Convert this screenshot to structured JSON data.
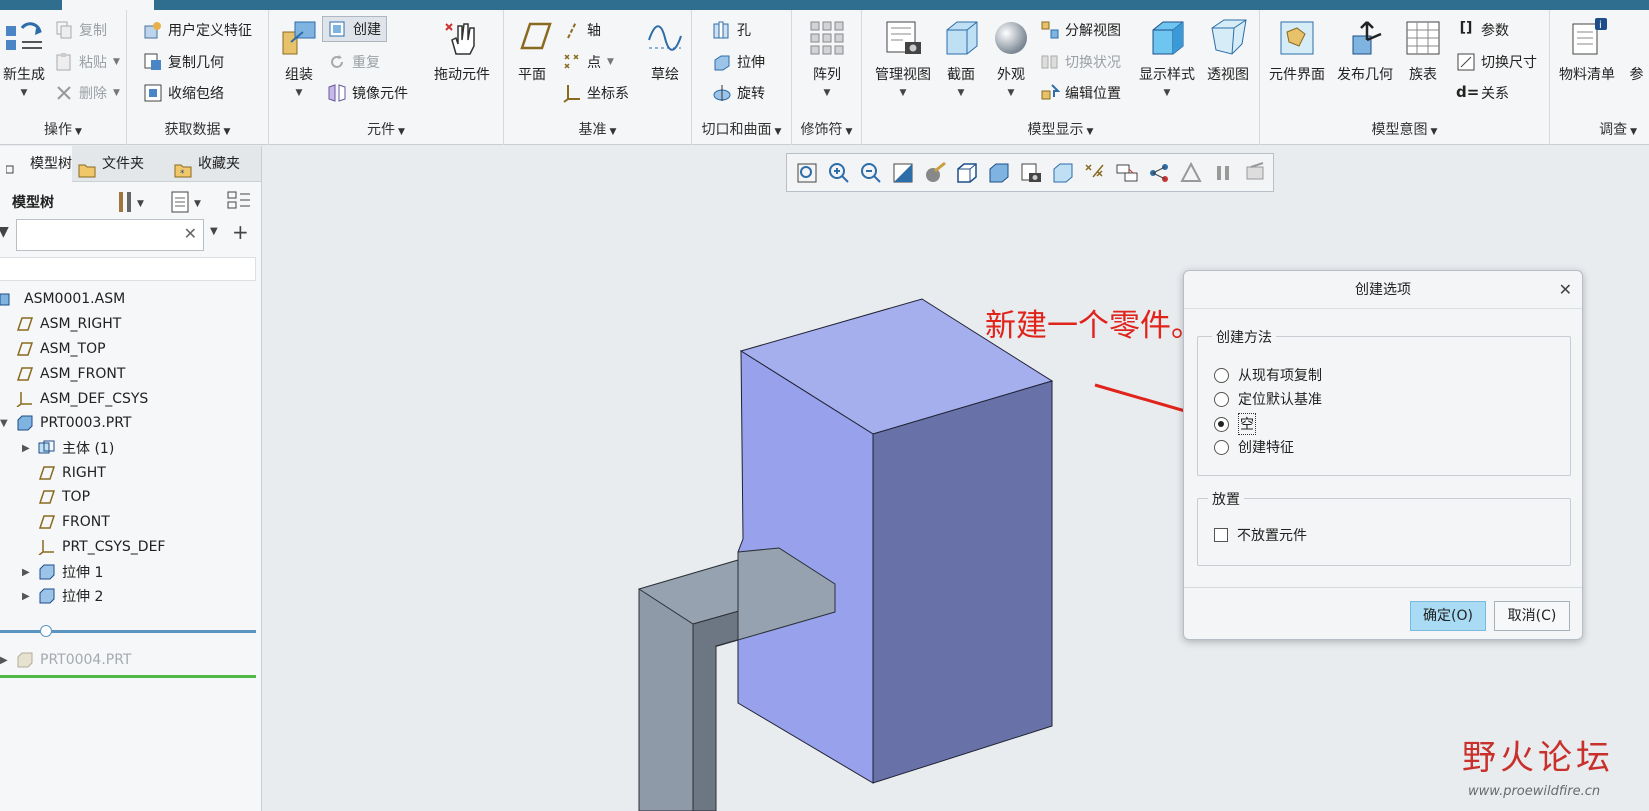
{
  "ribbon": {
    "groups": {
      "operations": "操作",
      "get_data": "获取数据",
      "component": "元件",
      "datum": "基准",
      "cut_surface": "切口和曲面",
      "modifiers": "修饰符",
      "model_display": "模型显示",
      "model_intent": "模型意图",
      "investigate": "调查"
    },
    "regenerate": "新生成",
    "copy": "复制",
    "paste": "粘贴",
    "delete": "删除",
    "user_defined_feature": "用户定义特征",
    "copy_geometry": "复制几何",
    "shrinkwrap": "收缩包络",
    "assemble": "组装",
    "create": "创建",
    "repeat": "重复",
    "mirror_component": "镜像元件",
    "drag_components": "拖动元件",
    "plane": "平面",
    "axis": "轴",
    "point": "点",
    "csys": "坐标系",
    "sketch": "草绘",
    "hole": "孔",
    "extrude": "拉伸",
    "revolve": "旋转",
    "pattern": "阵列",
    "manage_views": "管理视图",
    "section": "截面",
    "appearance": "外观",
    "exploded_view": "分解视图",
    "toggle_status": "切换状况",
    "edit_position": "编辑位置",
    "display_style": "显示样式",
    "perspective": "透视图",
    "component_interface": "元件界面",
    "publish_geometry": "发布几何",
    "family_table": "族表",
    "parameters": "参数",
    "switch_dimensions": "切换尺寸",
    "relations": "关系",
    "bom": "物料清单",
    "ref_cut": "参"
  },
  "panel": {
    "tabs": [
      "模型树",
      "文件夹",
      "收藏夹"
    ],
    "tree_title": "模型树",
    "filter_placeholder": "",
    "tree": [
      {
        "label": "ASM0001.ASM"
      },
      {
        "label": "ASM_RIGHT"
      },
      {
        "label": "ASM_TOP"
      },
      {
        "label": "ASM_FRONT"
      },
      {
        "label": "ASM_DEF_CSYS"
      },
      {
        "label": "PRT0003.PRT"
      },
      {
        "label": "主体 (1)"
      },
      {
        "label": "RIGHT"
      },
      {
        "label": "TOP"
      },
      {
        "label": "FRONT"
      },
      {
        "label": "PRT_CSYS_DEF"
      },
      {
        "label": "拉伸 1"
      },
      {
        "label": "拉伸 2"
      },
      {
        "label": "PRT0004.PRT"
      }
    ]
  },
  "dialog": {
    "title": "创建选项",
    "method_legend": "创建方法",
    "options": [
      "从现有项复制",
      "定位默认基准",
      "空",
      "创建特征"
    ],
    "selected_option": "空",
    "placement_legend": "放置",
    "no_place": "不放置元件",
    "ok": "确定(O)",
    "cancel": "取消(C)"
  },
  "annotation": "新建一个零件。选择空",
  "watermark": {
    "text": "野火论坛",
    "url": "www.proewildfire.cn"
  },
  "colors": {
    "box_front": "#98a2ec",
    "box_side": "#6872a8",
    "bracket": "#8e9aa8",
    "annotation": "#e0231b",
    "primary_button": "#a9dcf4"
  }
}
